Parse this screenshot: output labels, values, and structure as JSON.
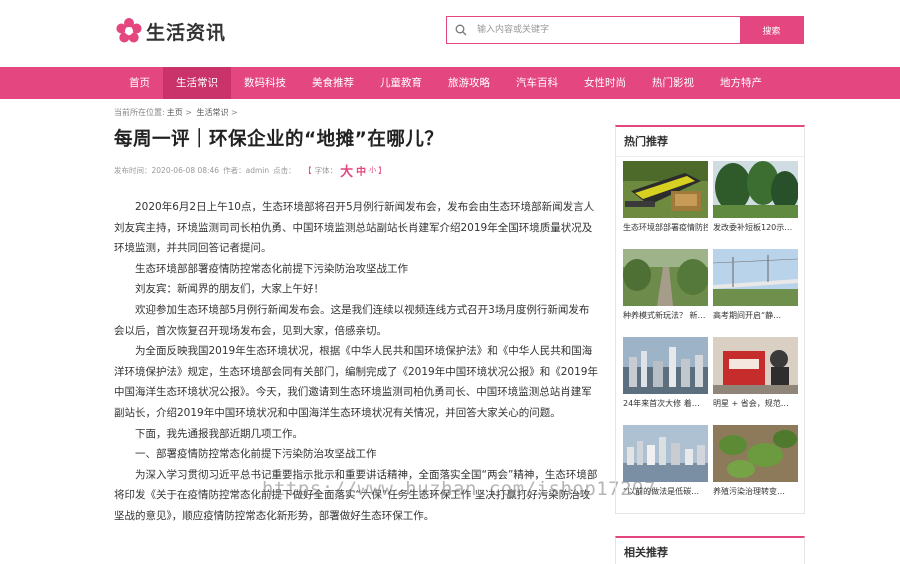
{
  "logo": {
    "text": "生活资讯",
    "brand_color": "#e4467f"
  },
  "search": {
    "placeholder": "输入内容或关键字",
    "button": "搜索"
  },
  "nav": {
    "items": [
      "首页",
      "生活常识",
      "数码科技",
      "美食推荐",
      "儿童教育",
      "旅游攻略",
      "汽车百科",
      "女性时尚",
      "热门影视",
      "地方特产"
    ],
    "active_index": 1
  },
  "breadcrumb": {
    "prefix": "当前所在位置:",
    "home": "主页",
    "sep1": ">",
    "category": "生活常识",
    "sep2": ">"
  },
  "article": {
    "title": "每周一评｜环保企业的“地摊”在哪儿？",
    "meta_time": "发布时间：2020-06-08 08:46",
    "meta_author": "作者：admin",
    "meta_clicks": "点击：",
    "font_label": "字体：",
    "font_big": "大",
    "font_mid": "中",
    "font_small": "小",
    "font_open": "【",
    "font_close": "】",
    "paragraphs": [
      "2020年6月2日上午10点，生态环境部将召开5月例行新闻发布会，发布会由生态环境部新闻发言人刘友宾主持，环境监测司司长柏仇勇、中国环境监测总站副站长肖建军介绍2019年全国环境质量状况及环境监测，并共同回答记者提问。",
      "生态环境部部署疫情防控常态化前提下污染防治攻坚战工作",
      "刘友宾：新闻界的朋友们，大家上午好！",
      "欢迎参加生态环境部5月例行新闻发布会。这是我们连续以视频连线方式召开3场月度例行新闻发布会以后，首次恢复召开现场发布会，见到大家，倍感亲切。",
      "为全面反映我国2019年生态环境状况，根据《中华人民共和国环境保护法》和《中华人民共和国海洋环境保护法》规定，生态环境部会同有关部门，编制完成了《2019年中国环境状况公报》和《2019年中国海洋生态环境状况公报》。今天，我们邀请到生态环境监测司柏仇勇司长、中国环境监测总站肖建军副站长，介绍2019年中国环境状况和中国海洋生态环境状况有关情况，并回答大家关心的问题。",
      "下面，我先通报我部近期几项工作。",
      "一、部署疫情防控常态化前提下污染防治攻坚战工作",
      "为深入学习贯彻习近平总书记重要指示批示和重要讲话精神，全面落实全国“两会”精神，生态环境部将印发《关于在疫情防控常态化前提下做好全面落实“六保”任务生态环保工作 坚决打赢打好污染防治攻坚战的意见》，顺应疫情防控常态化新形势，部署做好生态环保工作。"
    ]
  },
  "watermark": "https://www.huzhan.com/ishop17297",
  "sidebar": {
    "hot_title": "热门推荐",
    "hot_items": [
      {
        "title": "生态环境部部署疫情防控…",
        "image": "machine-photo"
      },
      {
        "title": "发改委补短板120示…",
        "image": "forest-photo"
      },
      {
        "title": "种养模式新玩法？ 新…",
        "image": "path-photo"
      },
      {
        "title": "高考期间开启“静…",
        "image": "bridge-photo"
      },
      {
        "title": "24年来首次大修 着…",
        "image": "city-photo"
      },
      {
        "title": "明星 + 省会，规范…",
        "image": "stall-photo"
      },
      {
        "title": "“以前的做法是低碳…",
        "image": "harbor-photo"
      },
      {
        "title": "养殖污染治理转变…",
        "image": "plant-photo"
      }
    ],
    "related_title": "相关推荐"
  }
}
